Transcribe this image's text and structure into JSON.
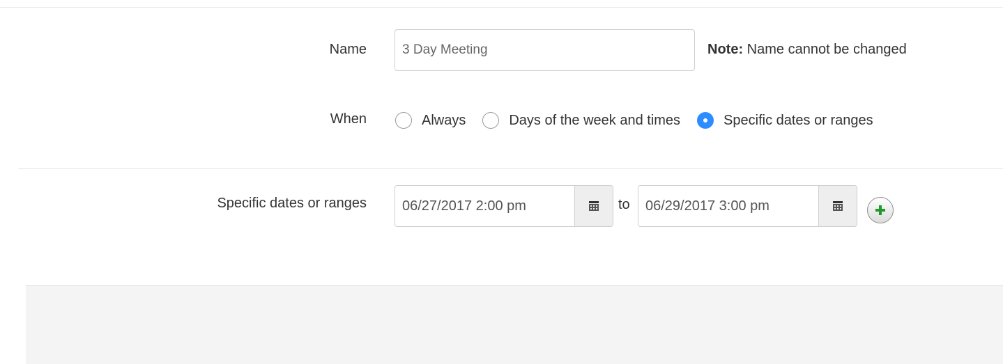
{
  "form": {
    "name": {
      "label": "Name",
      "value": "3 Day Meeting",
      "note_bold": "Note:",
      "note_text": " Name cannot be changed"
    },
    "when": {
      "label": "When",
      "options": [
        {
          "label": "Always",
          "selected": false
        },
        {
          "label": "Days of the week and times",
          "selected": false
        },
        {
          "label": "Specific dates or ranges",
          "selected": true
        }
      ]
    },
    "dates": {
      "label": "Specific dates or ranges",
      "start": "06/27/2017 2:00 pm",
      "separator": "to",
      "end": "06/29/2017 3:00 pm"
    }
  },
  "icons": {
    "calendar": "calendar-icon",
    "add": "plus-circle-icon"
  },
  "colors": {
    "accent": "#2d8cff",
    "add_green": "#1f9a2b"
  }
}
